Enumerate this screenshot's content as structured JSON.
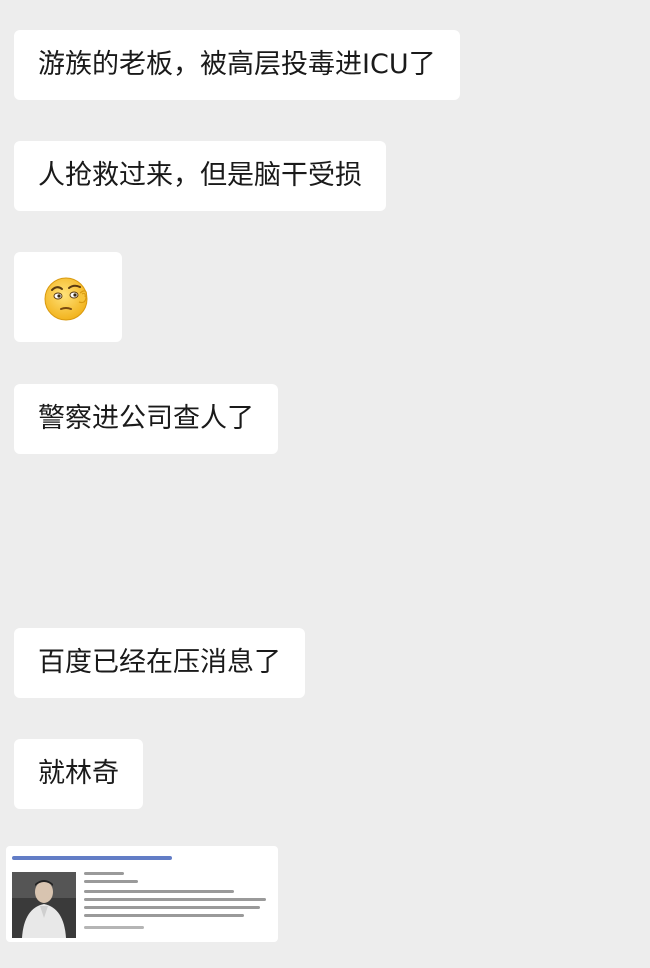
{
  "messages": [
    {
      "text": "游族的老板，被高层投毒进ICU了"
    },
    {
      "text": "人抢救过来，但是脑干受损"
    },
    {
      "sticker": "thinking-face-sticker"
    },
    {
      "text": "警察进公司查人了"
    },
    {
      "text": "百度已经在压消息了"
    },
    {
      "text": "就林奇"
    }
  ],
  "colors": {
    "background": "#ededed",
    "bubble": "#ffffff",
    "text": "#1a1a1a",
    "link": "#2d52b3"
  }
}
